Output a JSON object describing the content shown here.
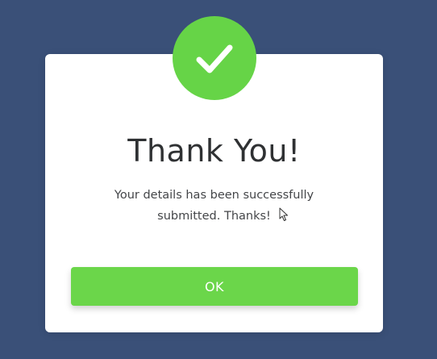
{
  "dialog": {
    "title": "Thank You!",
    "message_line1": "Your details has been successfully",
    "message_line2": "submitted. Thanks!",
    "ok_label": "OK",
    "icon": "checkmark-icon"
  },
  "colors": {
    "background": "#3a5078",
    "modal": "#ffffff",
    "accent": "#66d447",
    "button": "#6bd64a",
    "title_text": "#2f3133",
    "body_text": "#444649"
  }
}
